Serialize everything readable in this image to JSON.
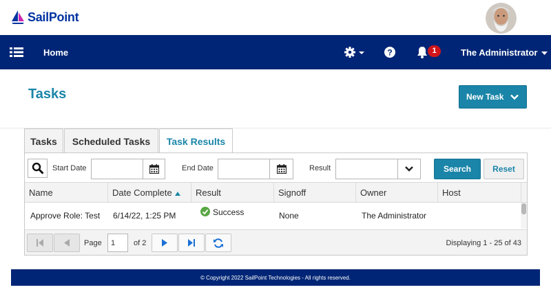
{
  "brand": {
    "name": "SailPoint",
    "color": "#0033a1"
  },
  "user_avatar": "user-avatar",
  "nav": {
    "menu_icon": "list-menu-icon",
    "home": "Home",
    "notifications_count": "1",
    "user": "The Administrator"
  },
  "page": {
    "title": "Tasks",
    "new_task": "New Task"
  },
  "tabs": [
    {
      "label": "Tasks",
      "active": false
    },
    {
      "label": "Scheduled Tasks",
      "active": false
    },
    {
      "label": "Task Results",
      "active": true
    }
  ],
  "filters": {
    "start_date_label": "Start Date",
    "start_date_value": "",
    "end_date_label": "End Date",
    "end_date_value": "",
    "result_label": "Result",
    "result_value": "",
    "search": "Search",
    "reset": "Reset"
  },
  "grid": {
    "columns": [
      "Name",
      "Date Complete",
      "Result",
      "Signoff",
      "Owner",
      "Host"
    ],
    "sorted_column": "Date Complete",
    "sort_direction": "ascending",
    "rows": [
      {
        "name": "Approve Role: Test",
        "date": "6/14/22, 1:25 PM",
        "result": "Success",
        "signoff": "None",
        "owner": "The Administrator",
        "host": ""
      }
    ]
  },
  "pager": {
    "page_label": "Page",
    "page_value": "1",
    "of_label": "of 2",
    "displaying": "Displaying 1 - 25 of 43"
  },
  "footer": {
    "text": "© Copyright 2022 SailPoint Technologies - All rights reserved."
  },
  "colors": {
    "nav_bg": "#002576",
    "accent": "#1a85a8",
    "badge": "#d0151b",
    "success": "#5aa745"
  }
}
